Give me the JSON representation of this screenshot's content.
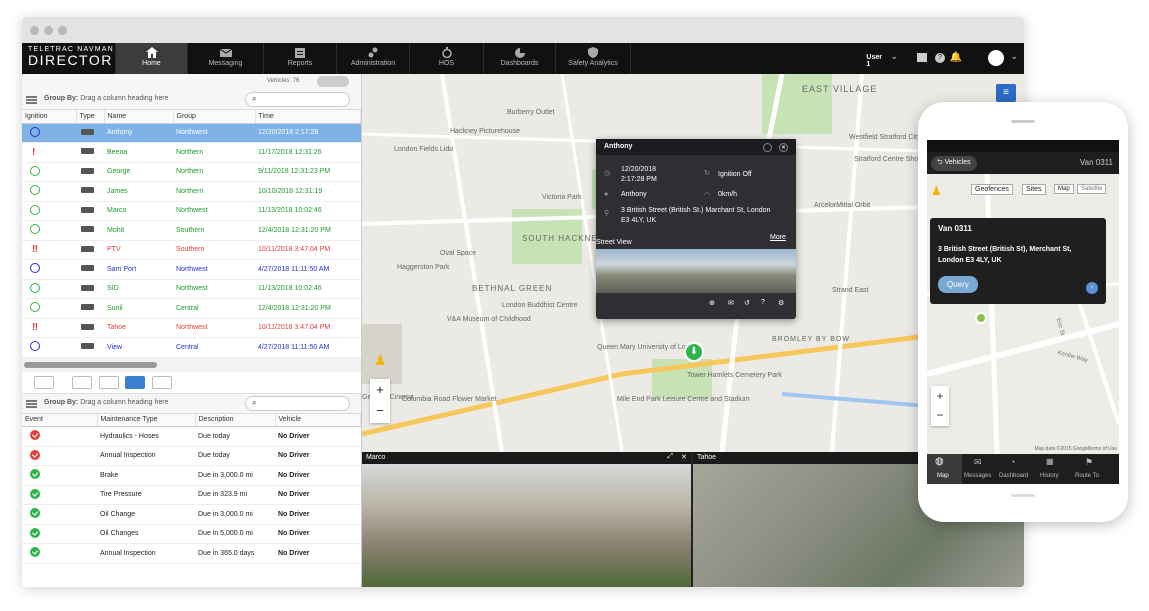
{
  "nav": {
    "brand_top": "TELETRAC NAVMAN",
    "brand_main": "DIRECTOR",
    "items": [
      "Home",
      "Messaging",
      "Reports",
      "Administration",
      "HOS",
      "Dashboards",
      "Safety Analytics"
    ],
    "user": "User 1"
  },
  "vehicles": {
    "count_label": "Vehicles: 76",
    "group_by": "Group By:",
    "group_hint": "Drag a column heading here",
    "columns": [
      "Ignition",
      "Type",
      "Name",
      "Group",
      "Time"
    ],
    "rows": [
      {
        "name": "Anthony",
        "group": "Northwest",
        "time": "12/20/2018 2:17:28",
        "color": "sel",
        "ign": "blue"
      },
      {
        "name": "Beena",
        "group": "Northern",
        "time": "11/17/2018 12:31:26",
        "color": "green",
        "ign": "excl"
      },
      {
        "name": "George",
        "group": "Northern",
        "time": "9/11/2018 12:31:23 PM",
        "color": "green",
        "ign": "green"
      },
      {
        "name": "James",
        "group": "Northern",
        "time": "10/10/2018 12:31:19",
        "color": "green",
        "ign": "green"
      },
      {
        "name": "Marco",
        "group": "Northwest",
        "time": "11/13/2018 10:02:46",
        "color": "green",
        "ign": "green"
      },
      {
        "name": "Mohit",
        "group": "Southern",
        "time": "12/4/2018 12:31:20 PM",
        "color": "green",
        "ign": "green"
      },
      {
        "name": "PTV",
        "group": "Southern",
        "time": "10/11/2018 3:47:04 PM",
        "color": "red",
        "ign": "excl2"
      },
      {
        "name": "Sam Port",
        "group": "Northwest",
        "time": "4/27/2018 11:11:50 AM",
        "color": "blue",
        "ign": "blue"
      },
      {
        "name": "SID",
        "group": "Northwest",
        "time": "11/13/2018 10:02:46",
        "color": "green",
        "ign": "green"
      },
      {
        "name": "Sunil",
        "group": "Central",
        "time": "12/4/2018 12:31:20 PM",
        "color": "green",
        "ign": "green"
      },
      {
        "name": "Tahoe",
        "group": "Northwest",
        "time": "10/11/2018 3:47:04 PM",
        "color": "red",
        "ign": "excl2"
      },
      {
        "name": "View",
        "group": "Central",
        "time": "4/27/2018 11:11:50 AM",
        "color": "blue",
        "ign": "blue"
      }
    ]
  },
  "maintenance": {
    "group_by": "Group By:",
    "group_hint": "Drag a column heading here",
    "columns": [
      "Event",
      "Maintenance Type",
      "Description",
      "Vehicle"
    ],
    "rows": [
      {
        "type": "Hydraulics - Hoses",
        "desc": "Due today",
        "vehicle": "No Driver",
        "status": "r"
      },
      {
        "type": "Annual Inspection",
        "desc": "Due today",
        "vehicle": "No Driver",
        "status": "r"
      },
      {
        "type": "Brake",
        "desc": "Due in 3,000.0 mi",
        "vehicle": "No Driver",
        "status": "g"
      },
      {
        "type": "Tire Pressure",
        "desc": "Due in 323.9 mi",
        "vehicle": "No Driver",
        "status": "g"
      },
      {
        "type": "Oil Change",
        "desc": "Due in 3,000.0 mi",
        "vehicle": "No Driver",
        "status": "g"
      },
      {
        "type": "Oil Changes",
        "desc": "Due in 5,000.0 mi",
        "vehicle": "No Driver",
        "status": "g"
      },
      {
        "type": "Annual Inspection",
        "desc": "Due in 365.0 days",
        "vehicle": "No Driver",
        "status": "g"
      }
    ]
  },
  "map": {
    "labels": [
      "EAST VILLAGE",
      "Burberry Outlet",
      "Hackney Picturehouse",
      "London Fields Lido",
      "Westfield Stratford City",
      "Stratford Centre Shopping Centre",
      "ArcelorMittal Orbit",
      "SOUTH HACKNEY",
      "Victoria Park",
      "Oval Space",
      "Haggerston Park",
      "V&A Museum of Childhood",
      "London Buddhist Centre",
      "BETHNAL GREEN",
      "Queen Mary University of London",
      "Tower Hamlets Cemetery Park",
      "Genesis Cinema",
      "Mile End Park Leisure Centre and Stadium",
      "Strand East",
      "BROMLEY BY BOW",
      "Columbia Road Flower Market"
    ]
  },
  "popup": {
    "name": "Anthony",
    "date": "12/20/2018",
    "time": "2:17:28 PM",
    "ignition": "Ignition Off",
    "driver": "Anthony",
    "speed": "0km/h",
    "address": "3 British Street (British St.) Marchant St, London E3 4LY, UK",
    "street_view": "Street View",
    "more": "More"
  },
  "cams": {
    "left": "Marco",
    "right": "Tahoe"
  },
  "phone": {
    "back": "Vehicles",
    "title": "Van 0311",
    "geofences": "Geofences",
    "sites": "Sites",
    "map": "Map",
    "satellite": "Satellite",
    "card_title": "Van 0311",
    "card_addr": "3 British Street (British St), Merchant St, London E3 4LY, UK",
    "query": "Query",
    "roads": [
      "Kenilw Way",
      "Eric St",
      "Forge Way"
    ],
    "tabs": [
      "Map",
      "Messages",
      "Dashboard",
      "History",
      "Route To"
    ],
    "copyright": "Map data ©2015 Google",
    "terms": "Terms of Use"
  }
}
